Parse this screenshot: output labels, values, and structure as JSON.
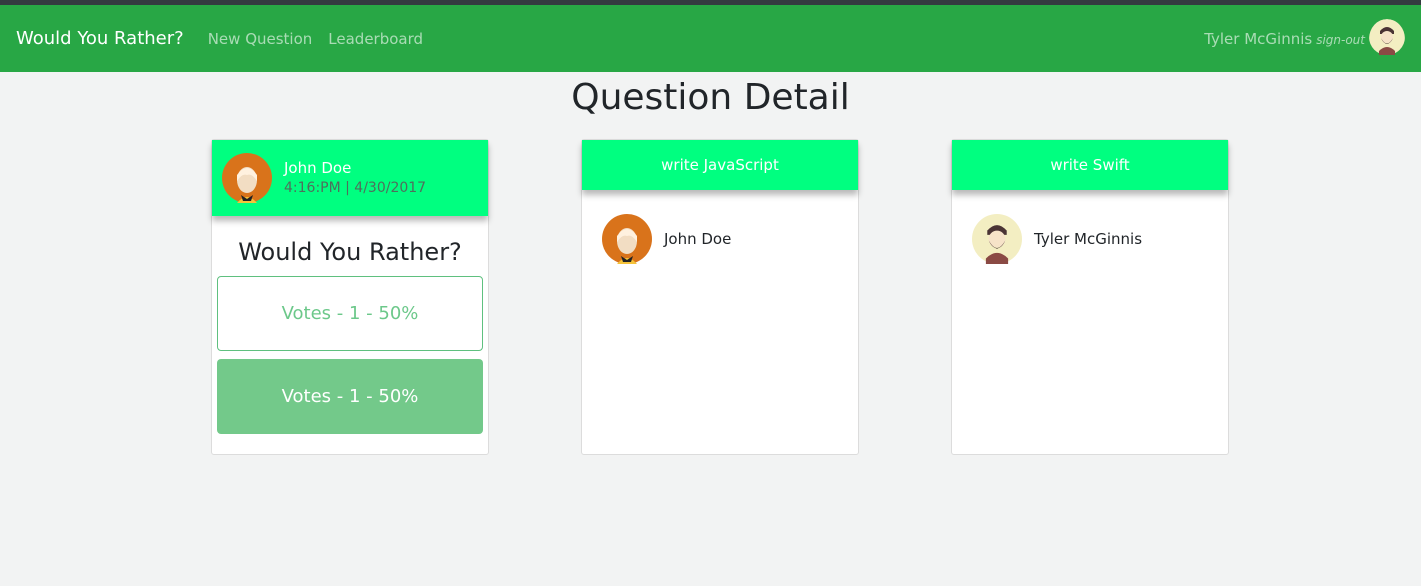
{
  "nav": {
    "brand": "Would You Rather?",
    "links": [
      "New Question",
      "Leaderboard"
    ],
    "user_name": "Tyler McGinnis",
    "signout_label": "sign-out",
    "accent_color": "#28a745"
  },
  "page_title": "Question Detail",
  "question_card": {
    "author": "John Doe",
    "timestamp": "4:16:PM | 4/30/2017",
    "title": "Would You Rather?",
    "options": [
      {
        "label": "Votes - 1 - 50%",
        "selected": false
      },
      {
        "label": "Votes - 1 - 50%",
        "selected": true
      }
    ]
  },
  "voter_cards": [
    {
      "header": "write JavaScript",
      "voters": [
        "John Doe"
      ]
    },
    {
      "header": "write Swift",
      "voters": [
        "Tyler McGinnis"
      ]
    }
  ],
  "colors": {
    "header_green": "#00ff80",
    "option_green": "#73c98a"
  }
}
